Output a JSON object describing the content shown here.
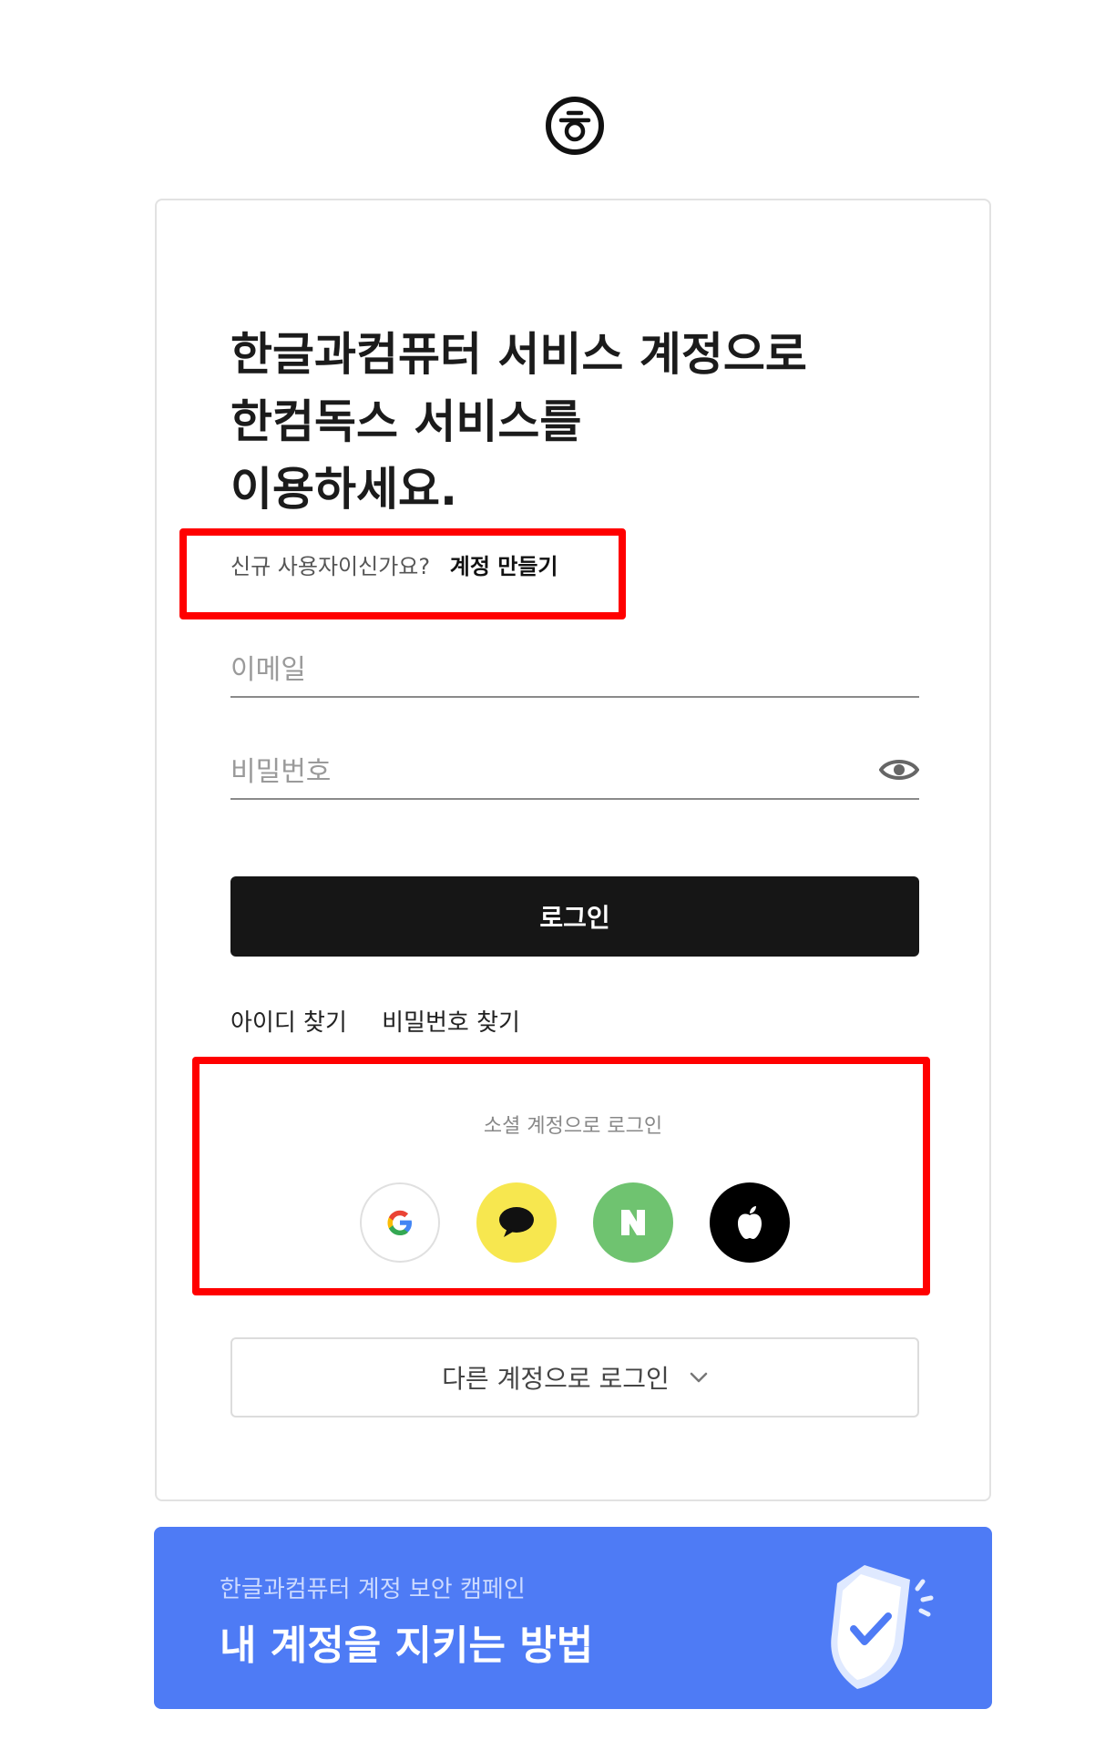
{
  "logo": {
    "icon": "hancom-logo-icon"
  },
  "heading": {
    "line1": "한글과컴퓨터 서비스 계정으로",
    "line2": "한컴독스 서비스를",
    "line3": "이용하세요."
  },
  "signup": {
    "question": "신규 사용자이신가요?",
    "link": "계정 만들기"
  },
  "form": {
    "email_placeholder": "이메일",
    "password_placeholder": "비밀번호",
    "login_label": "로그인"
  },
  "links": {
    "find_id": "아이디 찾기",
    "find_password": "비밀번호 찾기"
  },
  "social": {
    "title": "소셜 계정으로 로그인",
    "providers": [
      {
        "name": "google",
        "icon": "google-icon"
      },
      {
        "name": "kakao",
        "icon": "kakao-icon"
      },
      {
        "name": "naver",
        "icon": "naver-icon"
      },
      {
        "name": "apple",
        "icon": "apple-icon"
      }
    ]
  },
  "other_login": {
    "label": "다른 계정으로 로그인"
  },
  "banner": {
    "subtitle": "한글과컴퓨터 계정 보안 캠페인",
    "title": "내 계정을 지키는 방법"
  },
  "colors": {
    "highlight": "#ff0000",
    "button": "#161616",
    "banner": "#4e7bf5",
    "kakao": "#f7e74f",
    "naver": "#6fc370"
  }
}
